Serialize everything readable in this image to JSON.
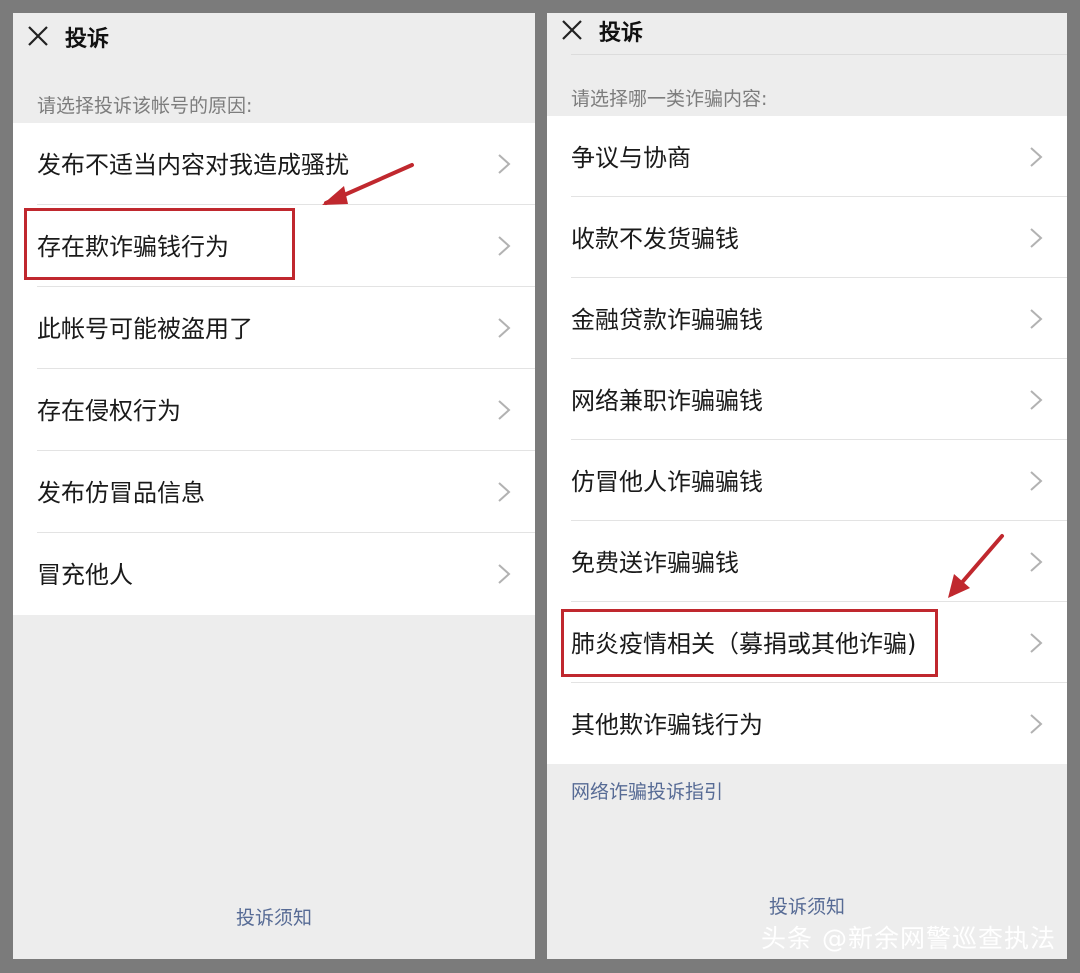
{
  "left": {
    "title": "投诉",
    "hint": "请选择投诉该帐号的原因:",
    "items": [
      {
        "label": "发布不适当内容对我造成骚扰"
      },
      {
        "label": "存在欺诈骗钱行为"
      },
      {
        "label": "此帐号可能被盗用了"
      },
      {
        "label": "存在侵权行为"
      },
      {
        "label": "发布仿冒品信息"
      },
      {
        "label": "冒充他人"
      }
    ],
    "footer": "投诉须知"
  },
  "right": {
    "title": "投诉",
    "hint": "请选择哪一类诈骗内容:",
    "items": [
      {
        "label": "争议与协商"
      },
      {
        "label": "收款不发货骗钱"
      },
      {
        "label": "金融贷款诈骗骗钱"
      },
      {
        "label": "网络兼职诈骗骗钱"
      },
      {
        "label": "仿冒他人诈骗骗钱"
      },
      {
        "label": "免费送诈骗骗钱"
      },
      {
        "label": "肺炎疫情相关（募捐或其他诈骗)"
      },
      {
        "label": "其他欺诈骗钱行为"
      }
    ],
    "guide_link": "网络诈骗投诉指引",
    "footer": "投诉须知"
  },
  "watermark": "头条 @新余网警巡查执法",
  "colors": {
    "highlight": "#c0282e",
    "link": "#576b95",
    "background": "#ededed"
  },
  "icons": {
    "close": "close-icon",
    "chevron": "chevron-right-icon",
    "annotation": "red-arrow-icon"
  }
}
